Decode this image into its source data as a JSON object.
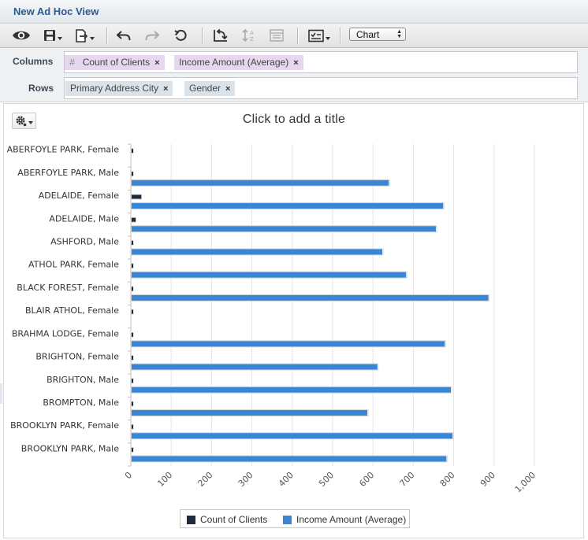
{
  "window": {
    "title": "New Ad Hoc View"
  },
  "toolbar": {
    "icons": [
      "eye-icon",
      "save-icon",
      "export-icon",
      "undo-icon",
      "redo-icon",
      "undo-all-icon",
      "switch-axes-icon",
      "sort-icon",
      "details-icon",
      "options-icon"
    ],
    "view_type": "Chart"
  },
  "shelves": {
    "columns": {
      "label": "Columns",
      "measures_marker": "#",
      "items": [
        {
          "label": "Count of Clients",
          "remove": "×"
        },
        {
          "label": "Income Amount (Average)",
          "remove": "×"
        }
      ]
    },
    "rows": {
      "label": "Rows",
      "items": [
        {
          "label": "Primary Address City",
          "remove": "×"
        },
        {
          "label": "Gender",
          "remove": "×"
        }
      ]
    }
  },
  "chart_title_placeholder": "Click to add a title",
  "chart_data": {
    "type": "bar",
    "orientation": "horizontal",
    "categories": [
      "ABERFOYLE PARK, Female",
      "ABERFOYLE PARK, Male",
      "ADELAIDE, Female",
      "ADELAIDE, Male",
      "ASHFORD, Male",
      "ATHOL PARK, Female",
      "BLACK FOREST, Female",
      "BLAIR ATHOL, Female",
      "BRAHMA LODGE, Female",
      "BRIGHTON, Female",
      "BRIGHTON, Male",
      "BROMPTON, Male",
      "BROOKLYN PARK, Female",
      "BROOKLYN PARK, Male"
    ],
    "series": [
      {
        "name": "Count of Clients",
        "color": "#1c2b3e",
        "values": [
          1,
          1,
          24,
          10,
          1,
          1,
          1,
          1,
          1,
          1,
          2,
          1,
          1,
          1
        ]
      },
      {
        "name": "Income Amount (Average)",
        "color": "#3a86d6",
        "values": [
          0,
          637,
          772,
          754,
          621,
          680,
          884,
          0,
          776,
          609,
          791,
          584,
          795,
          780
        ]
      }
    ],
    "x_ticks": [
      "0",
      "100",
      "200",
      "300",
      "400",
      "500",
      "600",
      "700",
      "800",
      "900",
      "1,000"
    ],
    "xlim": [
      0,
      1000
    ],
    "grid": true,
    "legend_position": "bottom"
  }
}
